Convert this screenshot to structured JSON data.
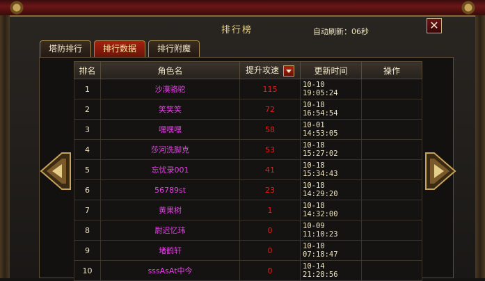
{
  "window": {
    "title": "排行榜",
    "auto_refresh": "自动刷新：06秒",
    "close_glyph": "✕"
  },
  "tabs": [
    {
      "label": "塔防排行",
      "active": false
    },
    {
      "label": "排行数据",
      "active": true
    },
    {
      "label": "排行附魔",
      "active": false
    }
  ],
  "table": {
    "headers": {
      "rank": "排名",
      "name": "角色名",
      "value": "提升攻速",
      "time": "更新时间",
      "action": "操作"
    },
    "rows": [
      {
        "rank": "1",
        "name": "沙漠骆驼",
        "value": "115",
        "time": "10-10 19:05:24",
        "action": ""
      },
      {
        "rank": "2",
        "name": "笑笑笑",
        "value": "72",
        "time": "10-18 16:54:54",
        "action": ""
      },
      {
        "rank": "3",
        "name": "嘿嘿嘿",
        "value": "58",
        "time": "10-01 14:53:05",
        "action": ""
      },
      {
        "rank": "4",
        "name": "莎河洗脚克",
        "value": "53",
        "time": "10-18 15:27:02",
        "action": ""
      },
      {
        "rank": "5",
        "name": "忘忧录001",
        "value": "41",
        "time": "10-18 15:34:43",
        "action": ""
      },
      {
        "rank": "6",
        "name": "56789st",
        "value": "23",
        "time": "10-18 14:29:20",
        "action": ""
      },
      {
        "rank": "7",
        "name": "黄果树",
        "value": "1",
        "time": "10-18 14:32:00",
        "action": ""
      },
      {
        "rank": "8",
        "name": "尉迟忆玮",
        "value": "0",
        "time": "10-09 11:10:23",
        "action": ""
      },
      {
        "rank": "9",
        "name": "堵鹤轩",
        "value": "0",
        "time": "10-10 07:18:47",
        "action": ""
      },
      {
        "rank": "10",
        "name": "sssAsAt中今",
        "value": "0",
        "time": "10-14 21:28:56",
        "action": ""
      }
    ]
  },
  "colors": {
    "name_text": "#e542e5",
    "value_text": "#f01818",
    "active_tab": "#a8210f"
  },
  "icons": {
    "prev": "left-arrow-icon",
    "next": "right-arrow-icon",
    "sort": "sort-dropdown-icon"
  }
}
